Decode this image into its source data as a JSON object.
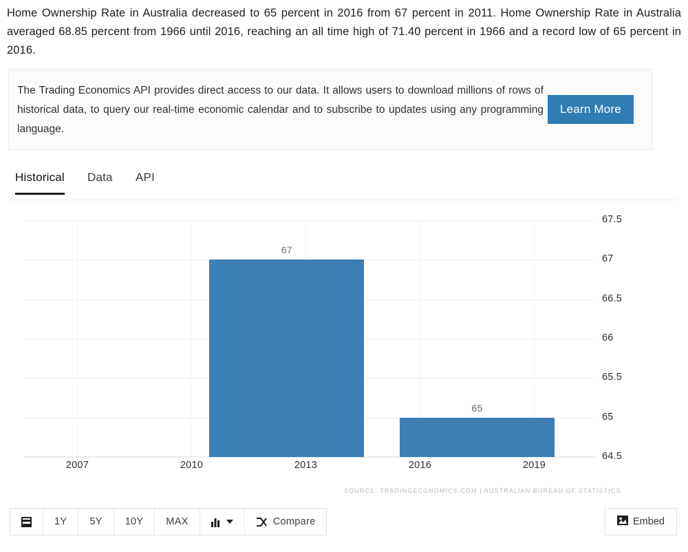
{
  "intro": {
    "paragraph": "Home Ownership Rate in Australia decreased to 65 percent in 2016 from 67 percent in 2011. Home Ownership Rate in Australia averaged 68.85 percent from 1966 until 2016, reaching an all time high of 71.40 percent in 1966 and a record low of 65 percent in 2016."
  },
  "promo": {
    "text": "The Trading Economics API provides direct access to our data. It allows users to download millions of rows of historical data, to query our real-time economic calendar and to subscribe to updates using any programming language.",
    "button_label": "Learn More",
    "button_color": "#2f7cb5"
  },
  "tabs": [
    {
      "label": "Historical",
      "active": true
    },
    {
      "label": "Data",
      "active": false
    },
    {
      "label": "API",
      "active": false
    }
  ],
  "chart_data": {
    "type": "bar",
    "title": "",
    "xlabel": "",
    "ylabel": "",
    "categories": [
      "2011",
      "2016"
    ],
    "values": [
      67,
      65
    ],
    "bar_labels": [
      "67",
      "65"
    ],
    "bar_color": "#3d7fb4",
    "xlim": [
      2005.6,
      2020.6
    ],
    "ylim": [
      64.5,
      67.5
    ],
    "xticks": [
      "2007",
      "2010",
      "2013",
      "2016",
      "2019"
    ],
    "xtick_values": [
      2007,
      2010,
      2013,
      2016,
      2019
    ],
    "yticks": [
      "67.5",
      "67",
      "66.5",
      "66",
      "65.5",
      "65",
      "64.5"
    ],
    "ytick_values": [
      67.5,
      67,
      66.5,
      66,
      65.5,
      65,
      64.5
    ],
    "grid": true,
    "legend": "none",
    "source": "SOURCE: TRADINGECONOMICS.COM | AUSTRALIAN BUREAU OF STATISTICS"
  },
  "toolbar": {
    "range_buttons": [
      "1Y",
      "5Y",
      "10Y",
      "MAX"
    ],
    "compare_label": "Compare",
    "embed_label": "Embed"
  }
}
